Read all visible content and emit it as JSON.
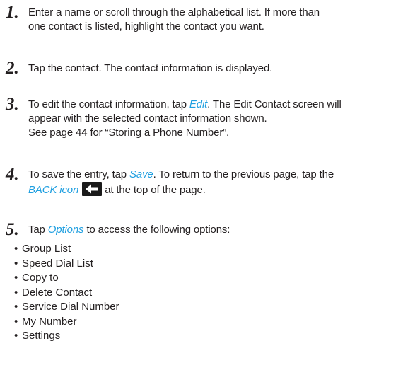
{
  "steps": [
    {
      "number": "1.",
      "line1": "Enter a name or scroll through the alphabetical list. If more than",
      "line2": "one contact is listed, highlight the contact you want."
    },
    {
      "number": "2.",
      "line1": "Tap the contact. The contact information is displayed."
    },
    {
      "number": "3.",
      "line1_pre": "To edit the contact information, tap ",
      "line1_link": "Edit",
      "line1_post": ". The Edit Contact screen will",
      "line2": "appear with the selected contact information shown.",
      "line3": "See page 44 for “Storing a Phone Number”."
    },
    {
      "number": "4.",
      "line1_pre": "To save the entry, tap ",
      "line1_link": "Save",
      "line1_post": ". To return to the previous page, tap the",
      "line2_link": "BACK icon",
      "line2_post": "at the top of the page."
    },
    {
      "number": "5.",
      "line1_pre": "Tap ",
      "line1_link": "Options",
      "line1_post": " to access the following options:"
    }
  ],
  "bullet_char": "•",
  "options": [
    "Group List",
    "Speed Dial List",
    "Copy to",
    "Delete Contact",
    "Service Dial Number",
    "My Number",
    "Settings"
  ],
  "colors": {
    "text": "#231f20",
    "link": "#1f9fe0",
    "icon_bg": "#1a1a1a",
    "icon_arrow": "#ffffff"
  },
  "icons": {
    "back": "back-arrow-icon"
  }
}
